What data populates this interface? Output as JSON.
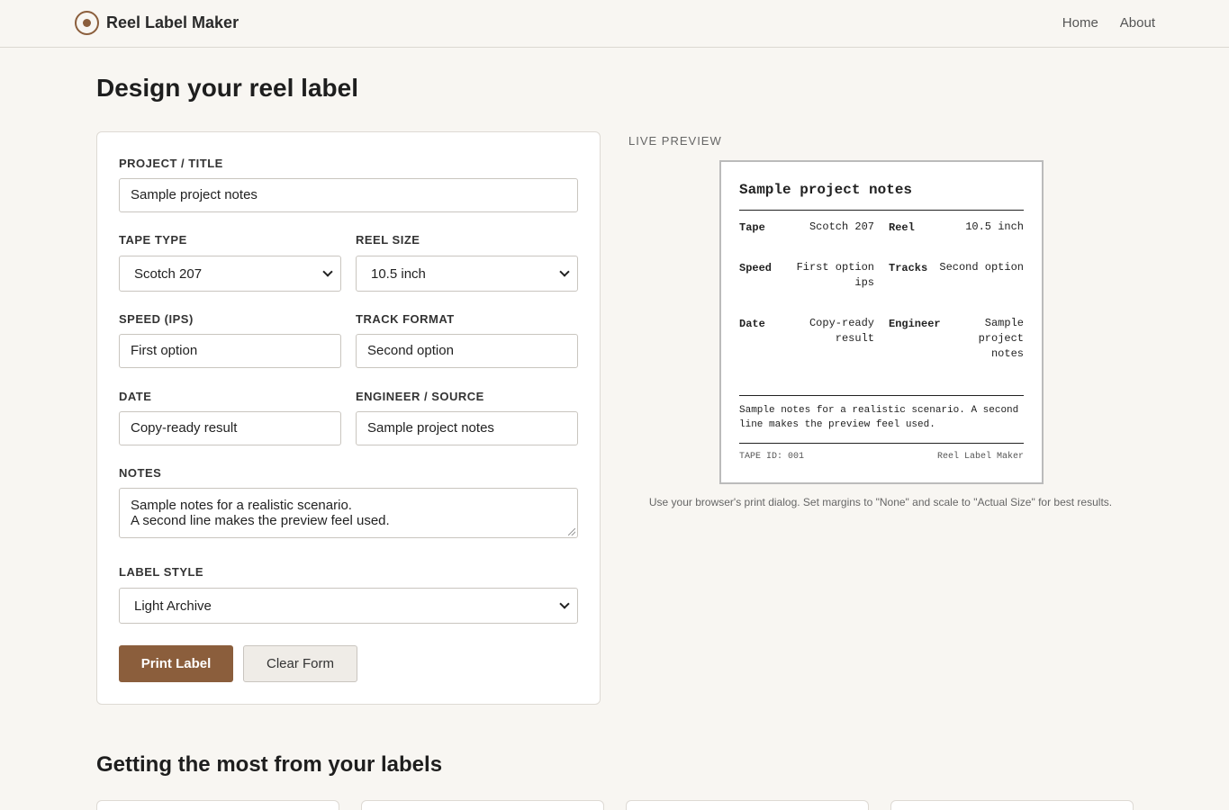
{
  "header": {
    "brand": "Reel Label Maker",
    "nav": [
      "Home",
      "About"
    ]
  },
  "page_title": "Design your reel label",
  "form": {
    "project_label": "PROJECT / TITLE",
    "project_value": "Sample project notes",
    "tape_type_label": "TAPE TYPE",
    "tape_type_value": "Scotch 207",
    "reel_size_label": "REEL SIZE",
    "reel_size_value": "10.5 inch",
    "speed_label": "SPEED (IPS)",
    "speed_value": "First option",
    "track_label": "TRACK FORMAT",
    "track_value": "Second option",
    "date_label": "DATE",
    "date_value": "Copy-ready result",
    "engineer_label": "ENGINEER / SOURCE",
    "engineer_value": "Sample project notes",
    "notes_label": "NOTES",
    "notes_line1": "Sample notes for a realistic scenario.",
    "notes_line2": "A second line makes the preview feel used.",
    "style_label": "LABEL STYLE",
    "style_value": "Light Archive",
    "print_button": "Print Label",
    "clear_button": "Clear Form"
  },
  "preview": {
    "heading": "LIVE PREVIEW",
    "title": "Sample project notes",
    "tape_key": "Tape",
    "tape_val": "Scotch 207",
    "reel_key": "Reel",
    "reel_val": "10.5 inch",
    "speed_key": "Speed",
    "speed_val_1": "First option",
    "speed_val_2": "ips",
    "tracks_key": "Tracks",
    "tracks_val": "Second option",
    "date_key": "Date",
    "date_val_1": "Copy-ready",
    "date_val_2": "result",
    "engineer_key": "Engineer",
    "engineer_val_1": "Sample",
    "engineer_val_2": "project",
    "engineer_val_3": "notes",
    "notes": "Sample notes for a realistic scenario. A second line makes the preview feel used.",
    "footer_left": "TAPE ID: 001",
    "footer_right": "Reel Label Maker",
    "print_note": "Use your browser's print dialog. Set margins to \"None\" and scale to \"Actual Size\" for best results."
  },
  "section_title": "Getting the most from your labels",
  "colors": {
    "accent": "#8b5e3c",
    "background": "#f8f6f2"
  }
}
